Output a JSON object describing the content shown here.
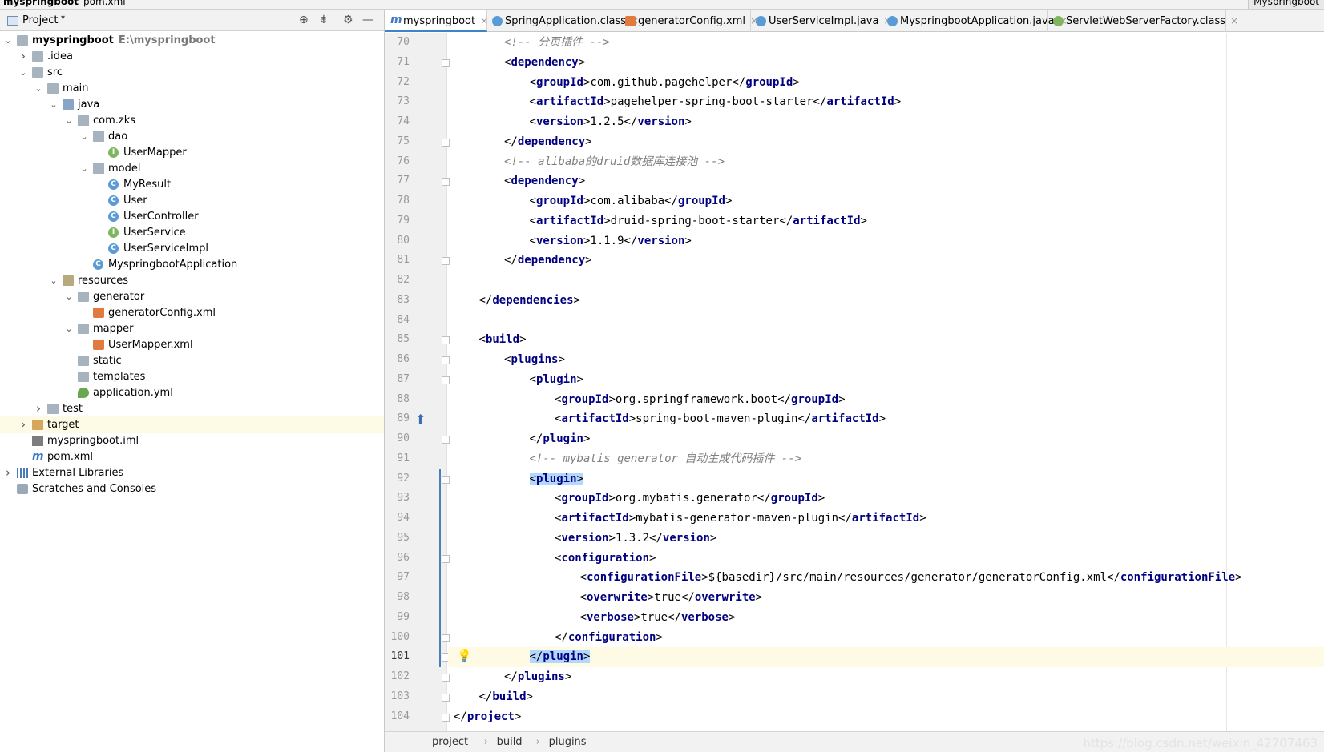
{
  "topbar": {
    "project_crumb": "myspringboot",
    "file_crumb": "pom.xml",
    "right_label": "Myspringboot"
  },
  "panel": {
    "title": "Project"
  },
  "tree": [
    {
      "label": "myspringboot",
      "path": "E:\\myspringboot",
      "depth": 0,
      "arrow": "down",
      "icon": "module-folder-icon",
      "bold": true
    },
    {
      "label": ".idea",
      "depth": 1,
      "arrow": "right",
      "icon": "folder-icon"
    },
    {
      "label": "src",
      "depth": 1,
      "arrow": "down",
      "icon": "folder-icon"
    },
    {
      "label": "main",
      "depth": 2,
      "arrow": "down",
      "icon": "folder-icon"
    },
    {
      "label": "java",
      "depth": 3,
      "arrow": "down",
      "icon": "source-folder-icon"
    },
    {
      "label": "com.zks",
      "depth": 4,
      "arrow": "down",
      "icon": "package-icon"
    },
    {
      "label": "dao",
      "depth": 5,
      "arrow": "down",
      "icon": "package-icon"
    },
    {
      "label": "UserMapper",
      "depth": 6,
      "arrow": "",
      "icon": "interface-icon"
    },
    {
      "label": "model",
      "depth": 5,
      "arrow": "down",
      "icon": "package-icon"
    },
    {
      "label": "MyResult",
      "depth": 6,
      "arrow": "",
      "icon": "class-icon"
    },
    {
      "label": "User",
      "depth": 6,
      "arrow": "",
      "icon": "class-icon"
    },
    {
      "label": "UserController",
      "depth": 6,
      "arrow": "",
      "icon": "class-icon"
    },
    {
      "label": "UserService",
      "depth": 6,
      "arrow": "",
      "icon": "interface-icon"
    },
    {
      "label": "UserServiceImpl",
      "depth": 6,
      "arrow": "",
      "icon": "class-icon"
    },
    {
      "label": "MyspringbootApplication",
      "depth": 5,
      "arrow": "",
      "icon": "spring-class-icon"
    },
    {
      "label": "resources",
      "depth": 3,
      "arrow": "down",
      "icon": "resources-folder-icon"
    },
    {
      "label": "generator",
      "depth": 4,
      "arrow": "down",
      "icon": "folder-icon"
    },
    {
      "label": "generatorConfig.xml",
      "depth": 5,
      "arrow": "",
      "icon": "xml-file-icon"
    },
    {
      "label": "mapper",
      "depth": 4,
      "arrow": "down",
      "icon": "folder-icon"
    },
    {
      "label": "UserMapper.xml",
      "depth": 5,
      "arrow": "",
      "icon": "xml-file-icon"
    },
    {
      "label": "static",
      "depth": 4,
      "arrow": "",
      "icon": "folder-icon"
    },
    {
      "label": "templates",
      "depth": 4,
      "arrow": "",
      "icon": "folder-icon"
    },
    {
      "label": "application.yml",
      "depth": 4,
      "arrow": "",
      "icon": "yml-file-icon"
    },
    {
      "label": "test",
      "depth": 2,
      "arrow": "right",
      "icon": "folder-icon"
    },
    {
      "label": "target",
      "depth": 1,
      "arrow": "right",
      "icon": "excluded-folder-icon",
      "highlight": true
    },
    {
      "label": "myspringboot.iml",
      "depth": 1,
      "arrow": "",
      "icon": "iml-file-icon"
    },
    {
      "label": "pom.xml",
      "depth": 1,
      "arrow": "",
      "icon": "maven-file-icon"
    },
    {
      "label": "External Libraries",
      "depth": 0,
      "arrow": "right",
      "icon": "libraries-icon"
    },
    {
      "label": "Scratches and Consoles",
      "depth": 0,
      "arrow": "",
      "icon": "scratches-icon"
    }
  ],
  "tabs": [
    {
      "label": "myspringboot",
      "icon": "maven-file-icon",
      "active": true
    },
    {
      "label": "SpringApplication.class",
      "icon": "class-file-icon"
    },
    {
      "label": "generatorConfig.xml",
      "icon": "xml-file-icon"
    },
    {
      "label": "UserServiceImpl.java",
      "icon": "class-icon"
    },
    {
      "label": "MyspringbootApplication.java",
      "icon": "spring-class-icon"
    },
    {
      "label": "ServletWebServerFactory.class",
      "icon": "interface-class-icon"
    }
  ],
  "code": [
    {
      "n": "70",
      "indent": 2,
      "parts": [
        [
          "cmt",
          "<!-- 分页插件 -->"
        ]
      ]
    },
    {
      "n": "71",
      "indent": 2,
      "fold": true,
      "parts": [
        [
          "br",
          "<"
        ],
        [
          "tag",
          "dependency"
        ],
        [
          "br",
          ">"
        ]
      ]
    },
    {
      "n": "72",
      "indent": 3,
      "parts": [
        [
          "br",
          "<"
        ],
        [
          "tag",
          "groupId"
        ],
        [
          "br",
          ">"
        ],
        [
          "txt",
          "com.github.pagehelper"
        ],
        [
          "br",
          "</"
        ],
        [
          "tag",
          "groupId"
        ],
        [
          "br",
          ">"
        ]
      ]
    },
    {
      "n": "73",
      "indent": 3,
      "parts": [
        [
          "br",
          "<"
        ],
        [
          "tag",
          "artifactId"
        ],
        [
          "br",
          ">"
        ],
        [
          "txt",
          "pagehelper-spring-boot-starter"
        ],
        [
          "br",
          "</"
        ],
        [
          "tag",
          "artifactId"
        ],
        [
          "br",
          ">"
        ]
      ]
    },
    {
      "n": "74",
      "indent": 3,
      "parts": [
        [
          "br",
          "<"
        ],
        [
          "tag",
          "version"
        ],
        [
          "br",
          ">"
        ],
        [
          "txt",
          "1.2.5"
        ],
        [
          "br",
          "</"
        ],
        [
          "tag",
          "version"
        ],
        [
          "br",
          ">"
        ]
      ]
    },
    {
      "n": "75",
      "indent": 2,
      "fold": true,
      "parts": [
        [
          "br",
          "</"
        ],
        [
          "tag",
          "dependency"
        ],
        [
          "br",
          ">"
        ]
      ]
    },
    {
      "n": "76",
      "indent": 2,
      "parts": [
        [
          "cmt",
          "<!-- alibaba的druid数据库连接池 -->"
        ]
      ]
    },
    {
      "n": "77",
      "indent": 2,
      "fold": true,
      "parts": [
        [
          "br",
          "<"
        ],
        [
          "tag",
          "dependency"
        ],
        [
          "br",
          ">"
        ]
      ]
    },
    {
      "n": "78",
      "indent": 3,
      "parts": [
        [
          "br",
          "<"
        ],
        [
          "tag",
          "groupId"
        ],
        [
          "br",
          ">"
        ],
        [
          "txt",
          "com.alibaba"
        ],
        [
          "br",
          "</"
        ],
        [
          "tag",
          "groupId"
        ],
        [
          "br",
          ">"
        ]
      ]
    },
    {
      "n": "79",
      "indent": 3,
      "parts": [
        [
          "br",
          "<"
        ],
        [
          "tag",
          "artifactId"
        ],
        [
          "br",
          ">"
        ],
        [
          "txt",
          "druid-spring-boot-starter"
        ],
        [
          "br",
          "</"
        ],
        [
          "tag",
          "artifactId"
        ],
        [
          "br",
          ">"
        ]
      ]
    },
    {
      "n": "80",
      "indent": 3,
      "parts": [
        [
          "br",
          "<"
        ],
        [
          "tag",
          "version"
        ],
        [
          "br",
          ">"
        ],
        [
          "txt",
          "1.1.9"
        ],
        [
          "br",
          "</"
        ],
        [
          "tag",
          "version"
        ],
        [
          "br",
          ">"
        ]
      ]
    },
    {
      "n": "81",
      "indent": 2,
      "fold": true,
      "parts": [
        [
          "br",
          "</"
        ],
        [
          "tag",
          "dependency"
        ],
        [
          "br",
          ">"
        ]
      ]
    },
    {
      "n": "82",
      "indent": 0,
      "parts": []
    },
    {
      "n": "83",
      "indent": 1,
      "parts": [
        [
          "br",
          "</"
        ],
        [
          "tag",
          "dependencies"
        ],
        [
          "br",
          ">"
        ]
      ]
    },
    {
      "n": "84",
      "indent": 0,
      "parts": []
    },
    {
      "n": "85",
      "indent": 1,
      "fold": true,
      "parts": [
        [
          "br",
          "<"
        ],
        [
          "tag",
          "build"
        ],
        [
          "br",
          ">"
        ]
      ]
    },
    {
      "n": "86",
      "indent": 2,
      "fold": true,
      "parts": [
        [
          "br",
          "<"
        ],
        [
          "tag",
          "plugins"
        ],
        [
          "br",
          ">"
        ]
      ]
    },
    {
      "n": "87",
      "indent": 3,
      "fold": true,
      "parts": [
        [
          "br",
          "<"
        ],
        [
          "tag",
          "plugin"
        ],
        [
          "br",
          ">"
        ]
      ]
    },
    {
      "n": "88",
      "indent": 4,
      "parts": [
        [
          "br",
          "<"
        ],
        [
          "tag",
          "groupId"
        ],
        [
          "br",
          ">"
        ],
        [
          "txt",
          "org.springframework.boot"
        ],
        [
          "br",
          "</"
        ],
        [
          "tag",
          "groupId"
        ],
        [
          "br",
          ">"
        ]
      ]
    },
    {
      "n": "89",
      "indent": 4,
      "run": true,
      "parts": [
        [
          "br",
          "<"
        ],
        [
          "tag",
          "artifactId"
        ],
        [
          "br",
          ">"
        ],
        [
          "txt",
          "spring-boot-maven-plugin"
        ],
        [
          "br",
          "</"
        ],
        [
          "tag",
          "artifactId"
        ],
        [
          "br",
          ">"
        ]
      ]
    },
    {
      "n": "90",
      "indent": 3,
      "fold": true,
      "parts": [
        [
          "br",
          "</"
        ],
        [
          "tag",
          "plugin"
        ],
        [
          "br",
          ">"
        ]
      ]
    },
    {
      "n": "91",
      "indent": 3,
      "parts": [
        [
          "cmt",
          "<!-- mybatis generator 自动生成代码插件 -->"
        ]
      ]
    },
    {
      "n": "92",
      "indent": 3,
      "fold": true,
      "selected": true,
      "parts": [
        [
          "br",
          "<"
        ],
        [
          "tag",
          "plugin"
        ],
        [
          "br",
          ">"
        ]
      ]
    },
    {
      "n": "93",
      "indent": 4,
      "parts": [
        [
          "br",
          "<"
        ],
        [
          "tag",
          "groupId"
        ],
        [
          "br",
          ">"
        ],
        [
          "txt",
          "org.mybatis.generator"
        ],
        [
          "br",
          "</"
        ],
        [
          "tag",
          "groupId"
        ],
        [
          "br",
          ">"
        ]
      ]
    },
    {
      "n": "94",
      "indent": 4,
      "parts": [
        [
          "br",
          "<"
        ],
        [
          "tag",
          "artifactId"
        ],
        [
          "br",
          ">"
        ],
        [
          "txt",
          "mybatis-generator-maven-plugin"
        ],
        [
          "br",
          "</"
        ],
        [
          "tag",
          "artifactId"
        ],
        [
          "br",
          ">"
        ]
      ]
    },
    {
      "n": "95",
      "indent": 4,
      "parts": [
        [
          "br",
          "<"
        ],
        [
          "tag",
          "version"
        ],
        [
          "br",
          ">"
        ],
        [
          "txt",
          "1.3.2"
        ],
        [
          "br",
          "</"
        ],
        [
          "tag",
          "version"
        ],
        [
          "br",
          ">"
        ]
      ]
    },
    {
      "n": "96",
      "indent": 4,
      "fold": true,
      "parts": [
        [
          "br",
          "<"
        ],
        [
          "tag",
          "configuration"
        ],
        [
          "br",
          ">"
        ]
      ]
    },
    {
      "n": "97",
      "indent": 5,
      "parts": [
        [
          "br",
          "<"
        ],
        [
          "tag",
          "configurationFile"
        ],
        [
          "br",
          ">"
        ],
        [
          "txt",
          "${basedir}/src/main/resources/generator/generatorConfig.xml"
        ],
        [
          "br",
          "</"
        ],
        [
          "tag",
          "configurationFile"
        ],
        [
          "br",
          ">"
        ]
      ]
    },
    {
      "n": "98",
      "indent": 5,
      "parts": [
        [
          "br",
          "<"
        ],
        [
          "tag",
          "overwrite"
        ],
        [
          "br",
          ">"
        ],
        [
          "txt",
          "true"
        ],
        [
          "br",
          "</"
        ],
        [
          "tag",
          "overwrite"
        ],
        [
          "br",
          ">"
        ]
      ]
    },
    {
      "n": "99",
      "indent": 5,
      "parts": [
        [
          "br",
          "<"
        ],
        [
          "tag",
          "verbose"
        ],
        [
          "br",
          ">"
        ],
        [
          "txt",
          "true"
        ],
        [
          "br",
          "</"
        ],
        [
          "tag",
          "verbose"
        ],
        [
          "br",
          ">"
        ]
      ]
    },
    {
      "n": "100",
      "indent": 4,
      "fold": true,
      "parts": [
        [
          "br",
          "</"
        ],
        [
          "tag",
          "configuration"
        ],
        [
          "br",
          ">"
        ]
      ]
    },
    {
      "n": "101",
      "indent": 3,
      "fold": true,
      "current": true,
      "bulb": true,
      "selected": true,
      "parts": [
        [
          "br",
          "</"
        ],
        [
          "tag",
          "plugin"
        ],
        [
          "br",
          ">"
        ]
      ]
    },
    {
      "n": "102",
      "indent": 2,
      "fold": true,
      "parts": [
        [
          "br",
          "</"
        ],
        [
          "tag",
          "plugins"
        ],
        [
          "br",
          ">"
        ]
      ]
    },
    {
      "n": "103",
      "indent": 1,
      "fold": true,
      "parts": [
        [
          "br",
          "</"
        ],
        [
          "tag",
          "build"
        ],
        [
          "br",
          ">"
        ]
      ]
    },
    {
      "n": "104",
      "indent": 0,
      "fold": true,
      "parts": [
        [
          "br",
          "</"
        ],
        [
          "tag",
          "project"
        ],
        [
          "br",
          ">"
        ]
      ]
    }
  ],
  "breadcrumb": [
    "project",
    "build",
    "plugins"
  ],
  "watermark": "https://blog.csdn.net/weixin_42707463"
}
